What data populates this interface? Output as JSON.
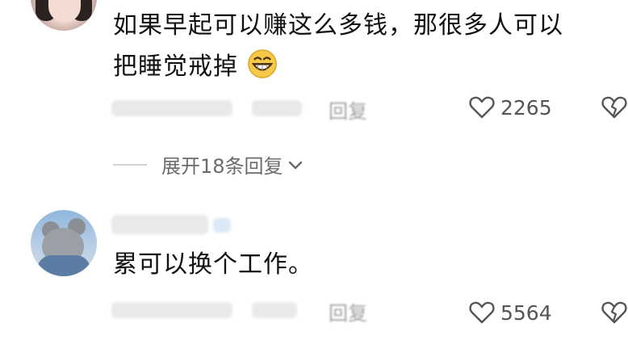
{
  "comments": [
    {
      "text_line1": "如果早起可以赚这么多钱，那很多人可以",
      "text_line2": "把睡觉戒掉",
      "emoji": "grinning-face-emoji",
      "reply_label": "回复",
      "like_count": "2265"
    },
    {
      "text": "累可以换个工作。",
      "reply_label": "回复",
      "like_count": "5564"
    }
  ],
  "expand_replies_label": "展开18条回复",
  "icons": [
    "heart-outline-icon",
    "broken-heart-icon",
    "chevron-down-icon"
  ],
  "colors": {
    "text": "#111111",
    "meta": "#a0a0a0",
    "icon": "#555555"
  }
}
